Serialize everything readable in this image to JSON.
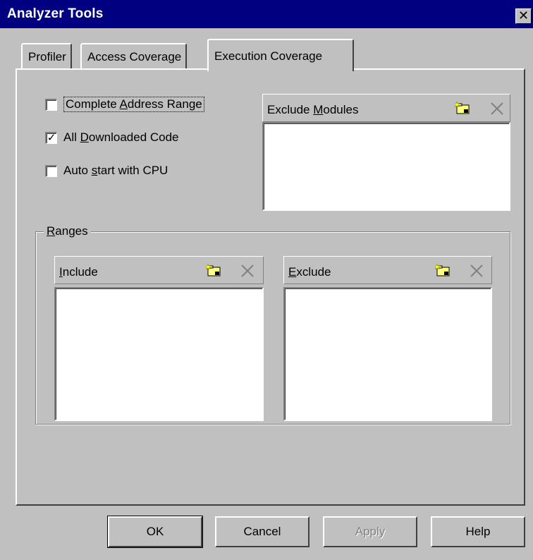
{
  "window": {
    "title": "Analyzer Tools",
    "close_glyph": "✕"
  },
  "tabs": [
    {
      "label": "Profiler",
      "active": false
    },
    {
      "label": "Access Coverage",
      "active": false
    },
    {
      "label": "Execution Coverage",
      "active": true
    }
  ],
  "options": {
    "complete_range": {
      "pre": "Complete ",
      "mnemonic": "A",
      "post": "ddress Range",
      "checked": false
    },
    "all_downloaded": {
      "pre": "All ",
      "mnemonic": "D",
      "post": "ownloaded Code",
      "checked": true
    },
    "auto_start": {
      "pre": "Auto ",
      "mnemonic": "s",
      "post": "tart with CPU",
      "checked": false
    }
  },
  "exclude_modules": {
    "pre": "Exclude ",
    "mnemonic": "M",
    "post": "odules"
  },
  "ranges": {
    "group": {
      "pre": "",
      "mnemonic": "R",
      "post": "anges"
    },
    "include": {
      "pre": "",
      "mnemonic": "I",
      "post": "nclude"
    },
    "exclude": {
      "pre": "",
      "mnemonic": "E",
      "post": "xclude"
    }
  },
  "icons": {
    "new": "new-folder-icon",
    "delete": "delete-x-icon",
    "check": "✓"
  },
  "buttons": {
    "ok": {
      "label": "OK"
    },
    "cancel": {
      "label": "Cancel"
    },
    "apply": {
      "label": "Apply",
      "enabled": false
    },
    "help": {
      "label": "Help"
    }
  },
  "colors": {
    "titlebar": "#000080",
    "face": "#c0c0c0",
    "icon_yellow": "#ffff80"
  }
}
